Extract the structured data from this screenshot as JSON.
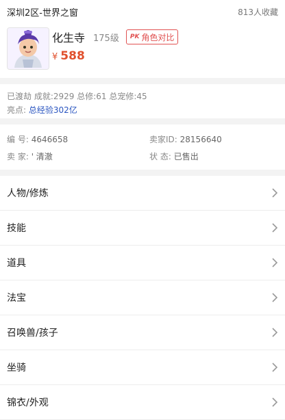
{
  "header": {
    "server": "深圳2区-世界之窗",
    "favorites": "813人收藏"
  },
  "role": {
    "name": "化生寺",
    "level": "175级",
    "compare_label": "角色对比",
    "compare_badge": "PK",
    "currency": "¥",
    "price": "588"
  },
  "stats": {
    "line1": "已渡劫 成就:2929 总修:61 总宠修:45",
    "highlight_label": "亮点:",
    "highlight_value": "总经验302亿"
  },
  "info": {
    "id_label": "编 号:",
    "id_value": "4646658",
    "seller_id_label": "卖家ID:",
    "seller_id_value": "28156640",
    "seller_label": "卖 家:",
    "seller_value": "' 清澈",
    "status_label": "状 态:",
    "status_value": "已售出"
  },
  "menu": [
    {
      "label": "人物/修炼"
    },
    {
      "label": "技能"
    },
    {
      "label": "道具"
    },
    {
      "label": "法宝"
    },
    {
      "label": "召唤兽/孩子"
    },
    {
      "label": "坐骑"
    },
    {
      "label": "锦衣/外观"
    }
  ],
  "colors": {
    "price": "#e0502d",
    "accent_red": "#e05050",
    "highlight_blue": "#2a55c0"
  }
}
